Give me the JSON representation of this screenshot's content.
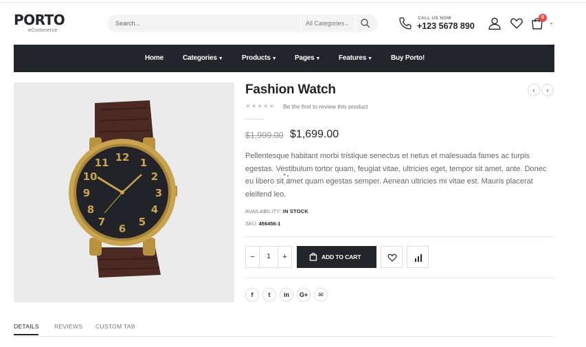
{
  "header": {
    "logo_text": "PORTO",
    "logo_sub": "eCommerce",
    "search_placeholder": "Search...",
    "category_select": "All Categories",
    "call_label": "CALL US NOW",
    "phone": "+123 5678 890",
    "cart_count": "0"
  },
  "nav": {
    "items": [
      {
        "label": "Home",
        "dropdown": false
      },
      {
        "label": "Categories",
        "dropdown": true
      },
      {
        "label": "Products",
        "dropdown": true
      },
      {
        "label": "Pages",
        "dropdown": true
      },
      {
        "label": "Features",
        "dropdown": true
      },
      {
        "label": "Buy Porto!",
        "dropdown": false
      }
    ]
  },
  "product": {
    "title": "Fashion Watch",
    "review_text": "Be the first to review this product",
    "rating": 0,
    "old_price": "$1,999.00",
    "price": "$1,699.00",
    "description": "Pellentesque habitant morbi tristique senectus et netus et malesuada fames ac turpis egestas. Vestibulum tortor quam, feugiat vitae, ultricies eget, tempor sit amet, ante. Donec eu libero sit amet quam egestas semper. Aenean ultricies mi vitae est. Mauris placerat eleifend leo.",
    "availability_label": "AVAILABILITY:",
    "availability_value": "IN STOCK",
    "sku_label": "SKU:",
    "sku_value": "456456-1",
    "qty_minus": "−",
    "qty": "1",
    "qty_plus": "+",
    "add_to_cart": "ADD TO CART"
  },
  "social": [
    "f",
    "t",
    "in",
    "G+",
    "✉"
  ],
  "tabs": [
    {
      "label": "DETAILS",
      "active": true
    },
    {
      "label": "REVIEWS",
      "active": false
    },
    {
      "label": "CUSTOM TAB",
      "active": false
    }
  ],
  "colors": {
    "dark": "#222529",
    "badge": "#e84b4b",
    "image_bg": "#ebebeb",
    "watch_gold": "#c9a44e"
  }
}
